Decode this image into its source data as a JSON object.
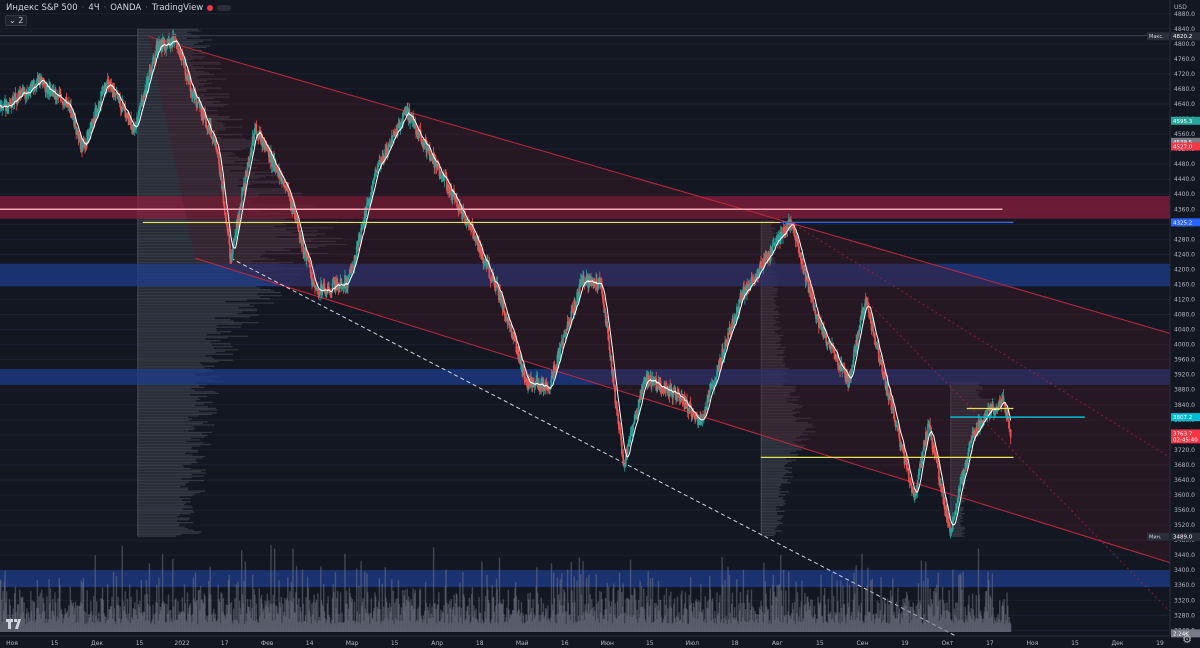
{
  "legend": {
    "symbol": "Индекс S&P 500",
    "interval": "4Ч",
    "broker": "OANDA",
    "platform": "TradingView",
    "indicator_count": "2"
  },
  "axis": {
    "currency": "USD",
    "tick_labels": [
      "4880.0",
      "4840.0",
      "4800.0",
      "4760.0",
      "4720.0",
      "4680.0",
      "4640.0",
      "4600.0",
      "4560.0",
      "4520.0",
      "4480.0",
      "4440.0",
      "4400.0",
      "4360.0",
      "4320.0",
      "4280.0",
      "4240.0",
      "4200.0",
      "4160.0",
      "4120.0",
      "4080.0",
      "4040.0",
      "4000.0",
      "3960.0",
      "3920.0",
      "3880.0",
      "3840.0",
      "3800.0",
      "3760.0",
      "3720.0",
      "3680.0",
      "3640.0",
      "3600.0",
      "3560.0",
      "3520.0",
      "3480.0",
      "3440.0",
      "3400.0",
      "3360.0",
      "3320.0",
      "3280.0",
      "3240.0"
    ],
    "x_labels": [
      "Ноя",
      "15",
      "Дек",
      "15",
      "2022",
      "17",
      "Фев",
      "14",
      "Мар",
      "15",
      "Апр",
      "18",
      "Май",
      "16",
      "Июн",
      "15",
      "Июл",
      "18",
      "Авг",
      "15",
      "Сен",
      "19",
      "Окт",
      "17",
      "Ноя",
      "15",
      "Дек",
      "19"
    ]
  },
  "price_tags": [
    {
      "text": "4820.2",
      "prefix": "Макс.",
      "color": "#2a2e39",
      "price": 4820.2
    },
    {
      "text": "4595.3",
      "prefix": "",
      "color": "#26a69a",
      "price": 4595.3
    },
    {
      "text": "4539.5",
      "prefix": "",
      "color": "#787b86",
      "price": 4539.5
    },
    {
      "text": "4527.0",
      "prefix": "",
      "color": "#f23645",
      "price": 4527.0
    },
    {
      "text": "4325.2",
      "prefix": "",
      "color": "#2962ff",
      "price": 4325.2
    },
    {
      "text": "3807.2",
      "prefix": "",
      "color": "#00bcd4",
      "price": 3807.2
    },
    {
      "text": "3763.7",
      "prefix": "",
      "color": "#f23645",
      "price": 3763.7
    },
    {
      "text": "02:45:40",
      "prefix": "",
      "color": "#f23645",
      "price": 3748
    },
    {
      "text": "3489.0",
      "prefix": "Мин.",
      "color": "#2a2e39",
      "price": 3489.0
    },
    {
      "text": "2.24K",
      "prefix": "",
      "color": "#787b86",
      "price": 3232
    }
  ],
  "colors": {
    "background": "#131722",
    "up": "#26a69a",
    "down": "#ef5350",
    "ma": "#ffffff",
    "zone_red": "#f23645",
    "zone_blue": "#2962ff",
    "level_yellow": "#f0e14a",
    "level_cyan": "#00bcd4"
  },
  "chart_data": {
    "type": "candlestick",
    "title": "Индекс S&P 500 · 4Ч · OANDA",
    "ylim": [
      3225,
      4890
    ],
    "x_range": [
      "2021-11-01",
      "2023-01-01"
    ],
    "close_path": [
      [
        "2021-11-01",
        4620
      ],
      [
        "2021-11-15",
        4700
      ],
      [
        "2021-11-26",
        4640
      ],
      [
        "2021-12-01",
        4520
      ],
      [
        "2021-12-10",
        4700
      ],
      [
        "2021-12-20",
        4570
      ],
      [
        "2021-12-28",
        4790
      ],
      [
        "2022-01-04",
        4810
      ],
      [
        "2022-01-10",
        4670
      ],
      [
        "2022-01-19",
        4530
      ],
      [
        "2022-01-24",
        4230
      ],
      [
        "2022-02-02",
        4580
      ],
      [
        "2022-02-14",
        4400
      ],
      [
        "2022-02-24",
        4140
      ],
      [
        "2022-03-08",
        4170
      ],
      [
        "2022-03-18",
        4460
      ],
      [
        "2022-03-29",
        4620
      ],
      [
        "2022-04-11",
        4450
      ],
      [
        "2022-04-22",
        4300
      ],
      [
        "2022-05-02",
        4130
      ],
      [
        "2022-05-12",
        3900
      ],
      [
        "2022-05-20",
        3890
      ],
      [
        "2022-06-01",
        4170
      ],
      [
        "2022-06-08",
        4160
      ],
      [
        "2022-06-16",
        3680
      ],
      [
        "2022-06-24",
        3910
      ],
      [
        "2022-07-07",
        3860
      ],
      [
        "2022-07-14",
        3790
      ],
      [
        "2022-07-29",
        4130
      ],
      [
        "2022-08-16",
        4325
      ],
      [
        "2022-08-26",
        4060
      ],
      [
        "2022-09-06",
        3900
      ],
      [
        "2022-09-12",
        4120
      ],
      [
        "2022-09-30",
        3590
      ],
      [
        "2022-10-05",
        3790
      ],
      [
        "2022-10-13",
        3500
      ],
      [
        "2022-10-21",
        3760
      ],
      [
        "2022-11-01",
        3860
      ],
      [
        "2022-11-04",
        3770
      ]
    ],
    "moving_average": "smoothed close",
    "zones": [
      {
        "kind": "supply",
        "color": "red",
        "from": 4335,
        "to": 4395
      },
      {
        "kind": "demand",
        "color": "blue",
        "from": 4155,
        "to": 4215
      },
      {
        "kind": "demand",
        "color": "blue",
        "from": 3893,
        "to": 3935
      },
      {
        "kind": "demand",
        "color": "blue",
        "from": 3355,
        "to": 3400
      }
    ],
    "levels": [
      {
        "price": 4360,
        "color": "pink",
        "from": "2021-11-01",
        "to": "2022-11-01"
      },
      {
        "price": 4325,
        "color": "yellow",
        "from": "2021-12-23",
        "to": "2022-11-05"
      },
      {
        "price": 4325,
        "color": "blue",
        "from": "2022-08-12",
        "to": "2022-11-05"
      },
      {
        "price": 3807,
        "color": "cyan",
        "from": "2022-10-13",
        "to": "2022-12-01"
      },
      {
        "price": 3830,
        "color": "yellow",
        "from": "2022-10-19",
        "to": "2022-11-05"
      },
      {
        "price": 3700,
        "color": "yellow",
        "from": "2022-08-05",
        "to": "2022-11-05"
      }
    ],
    "trend_channel": [
      {
        "from": [
          "2021-12-25",
          4820
        ],
        "to": [
          "2023-01-01",
          4030
        ]
      },
      {
        "from": [
          "2022-01-11",
          4230
        ],
        "to": [
          "2023-01-01",
          3420
        ]
      }
    ],
    "trend_line_dashed": {
      "from": [
        "2022-01-24",
        4230
      ],
      "to": [
        "2022-10-15",
        3225
      ]
    },
    "max": 4820.2,
    "min": 3489.0,
    "last": 3763.7
  }
}
